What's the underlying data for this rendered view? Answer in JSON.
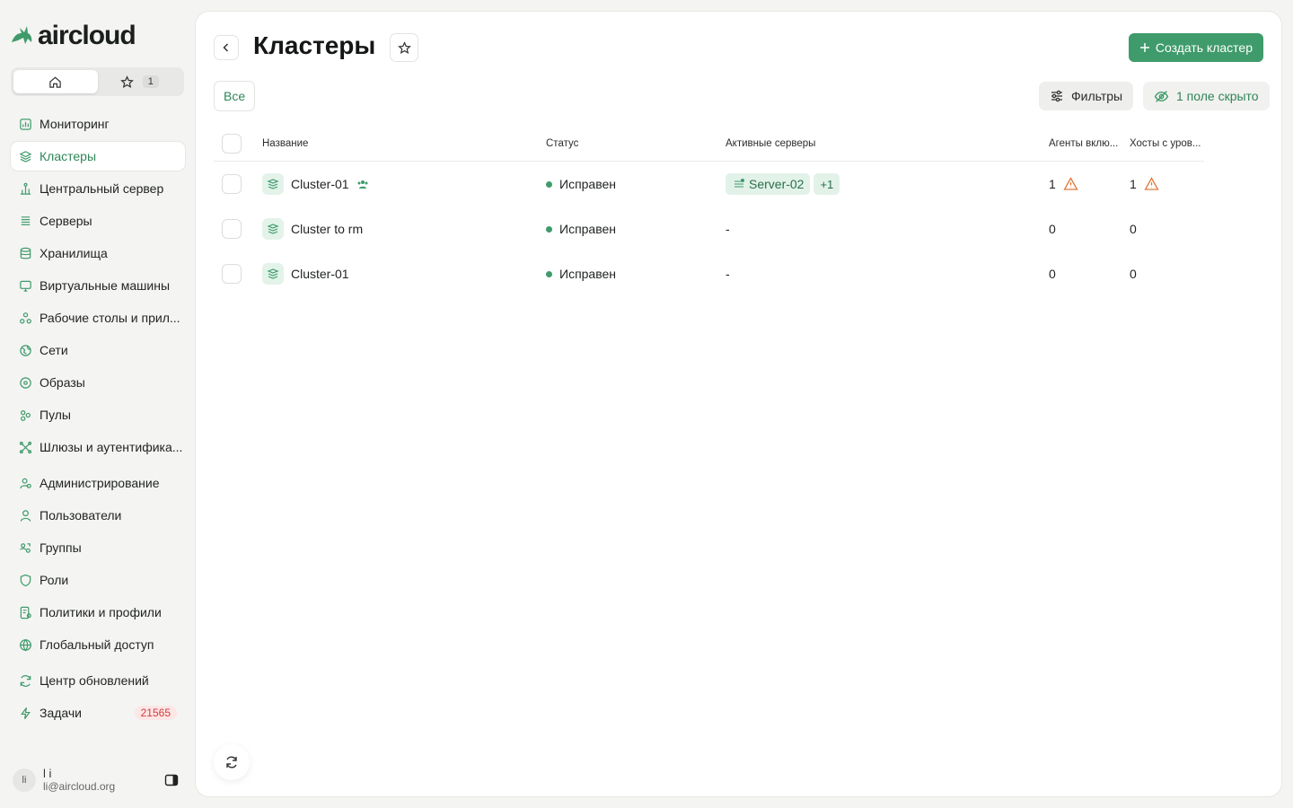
{
  "brand": {
    "name": "aircloud",
    "accent": "#3f9b6b"
  },
  "sidebar": {
    "favorites_count": "1",
    "items": [
      {
        "label": "Мониторинг",
        "icon": "monitoring-icon"
      },
      {
        "label": "Кластеры",
        "icon": "layers-icon",
        "active": true
      },
      {
        "label": "Центральный сервер",
        "icon": "central-server-icon"
      },
      {
        "label": "Серверы",
        "icon": "servers-icon"
      },
      {
        "label": "Хранилища",
        "icon": "storage-icon"
      },
      {
        "label": "Виртуальные машины",
        "icon": "monitor-icon"
      },
      {
        "label": "Рабочие столы и прил...",
        "icon": "desktops-icon"
      },
      {
        "label": "Сети",
        "icon": "network-icon"
      },
      {
        "label": "Образы",
        "icon": "disc-icon"
      },
      {
        "label": "Пулы",
        "icon": "pools-icon"
      },
      {
        "label": "Шлюзы и аутентифика...",
        "icon": "gateway-icon"
      },
      {
        "label": "Администрирование",
        "icon": "admin-icon"
      },
      {
        "label": "Пользователи",
        "icon": "user-icon"
      },
      {
        "label": "Группы",
        "icon": "groups-icon"
      },
      {
        "label": "Роли",
        "icon": "shield-icon"
      },
      {
        "label": "Политики и профили",
        "icon": "policy-icon"
      },
      {
        "label": "Глобальный доступ",
        "icon": "globe-icon"
      },
      {
        "label": "Центр обновлений",
        "icon": "refresh-icon"
      },
      {
        "label": "Задачи",
        "icon": "bolt-icon",
        "badge": "21565"
      }
    ],
    "user": {
      "initials": "li",
      "name": "l i",
      "email": "li@aircloud.org"
    }
  },
  "page": {
    "title": "Кластеры",
    "create_label": "Создать кластер",
    "filter_all": "Все",
    "filters_label": "Фильтры",
    "hidden_fields_label": "1 поле скрыто"
  },
  "table": {
    "columns": {
      "name": "Название",
      "status": "Статус",
      "servers": "Активные серверы",
      "agents": "Агенты вклю...",
      "hosts": "Хосты с уров..."
    },
    "rows": [
      {
        "name": "Cluster-01",
        "status": "Исправен",
        "server": "Server-02",
        "more": "+1",
        "agents": "1",
        "hosts": "1"
      },
      {
        "name": "Cluster to rm",
        "status": "Исправен",
        "servers_empty": "-",
        "agents": "0",
        "hosts": "0"
      },
      {
        "name": "Cluster-01",
        "status": "Исправен",
        "servers_empty": "-",
        "agents": "0",
        "hosts": "0"
      }
    ]
  }
}
